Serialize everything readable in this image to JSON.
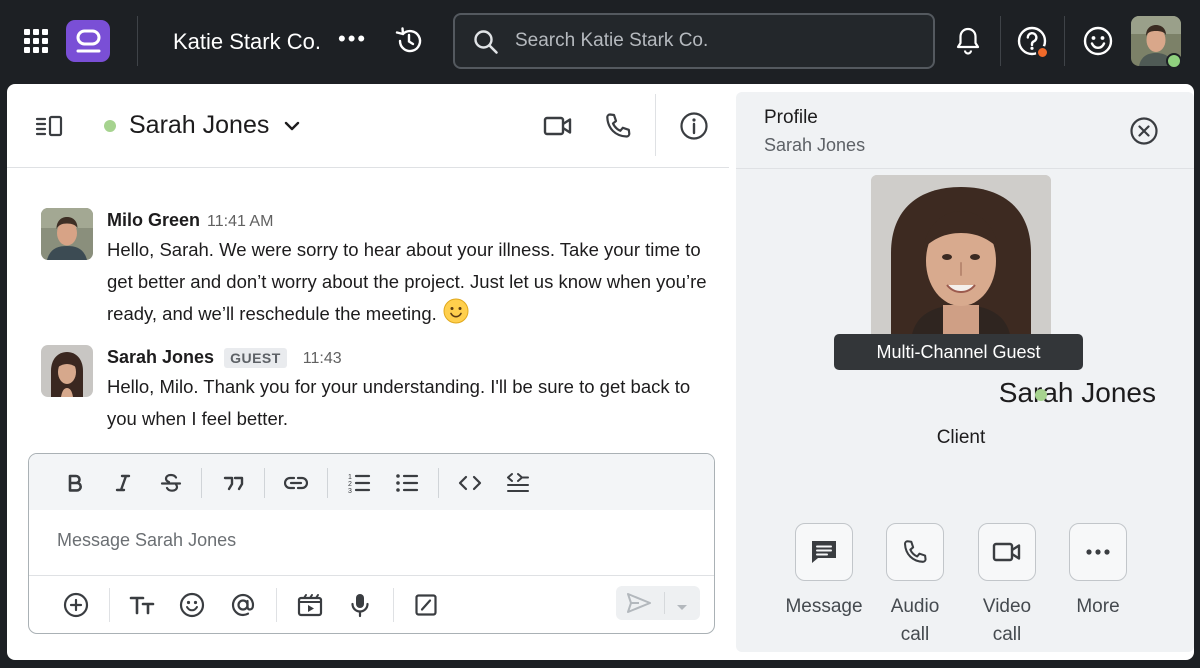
{
  "topbar": {
    "workspace_name": "Katie Stark Co.",
    "more_label": "•••",
    "search_placeholder": "Search Katie Stark Co."
  },
  "chat": {
    "title": "Sarah Jones",
    "messages": [
      {
        "author": "Milo Green",
        "time": "11:41 AM",
        "text": "Hello, Sarah. We were sorry to hear about your illness. Take your time to get better and don’t worry about the project. Just let us know when you’re ready, and we’ll reschedule the meeting."
      },
      {
        "author": "Sarah Jones",
        "badge": "GUEST",
        "time": "11:43",
        "text": "Hello, Milo. Thank you for your understanding. I'll be sure to get back to you when I feel better."
      }
    ],
    "composer_placeholder": "Message Sarah Jones"
  },
  "profile": {
    "label": "Profile",
    "subtitle": "Sarah Jones",
    "badge": "Multi-Channel Guest",
    "name": "Sarah Jones",
    "role": "Client",
    "actions": [
      "Message",
      "Audio call",
      "Video call",
      "More"
    ]
  },
  "colors": {
    "topbar_bg": "#1d2024",
    "brand_purple": "#7a4fd6",
    "online_green": "#a6d38f",
    "notification_orange": "#f06a2a"
  },
  "icons": [
    "apps-grid-icon",
    "app-logo",
    "history-icon",
    "search-icon",
    "bell-icon",
    "help-icon",
    "emoji-icon",
    "sidebar-toggle-icon",
    "chevron-down-icon",
    "video-icon",
    "phone-icon",
    "info-icon",
    "close-icon"
  ]
}
